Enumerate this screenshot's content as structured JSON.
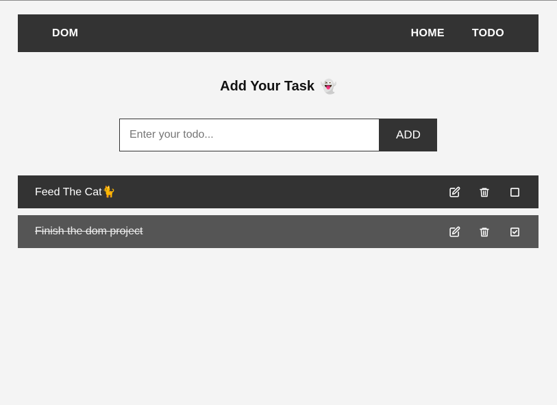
{
  "navbar": {
    "brand": "DOM",
    "links": [
      {
        "label": "HOME"
      },
      {
        "label": "TODO"
      }
    ]
  },
  "heading": {
    "title": "Add Your Task",
    "emoji": "👻"
  },
  "form": {
    "placeholder": "Enter your todo...",
    "value": "",
    "add_label": "ADD"
  },
  "todos": [
    {
      "text": "Feed The Cat🐈",
      "completed": false,
      "icons": [
        "edit-icon",
        "trash-icon",
        "checkbox-empty-icon"
      ]
    },
    {
      "text": "Finish the dom project",
      "completed": true,
      "icons": [
        "edit-icon",
        "trash-icon",
        "checkbox-checked-icon"
      ]
    }
  ],
  "colors": {
    "background": "#f4f4f4",
    "dark": "#333333",
    "completed_row": "#555555",
    "text_light": "#ffffff"
  }
}
